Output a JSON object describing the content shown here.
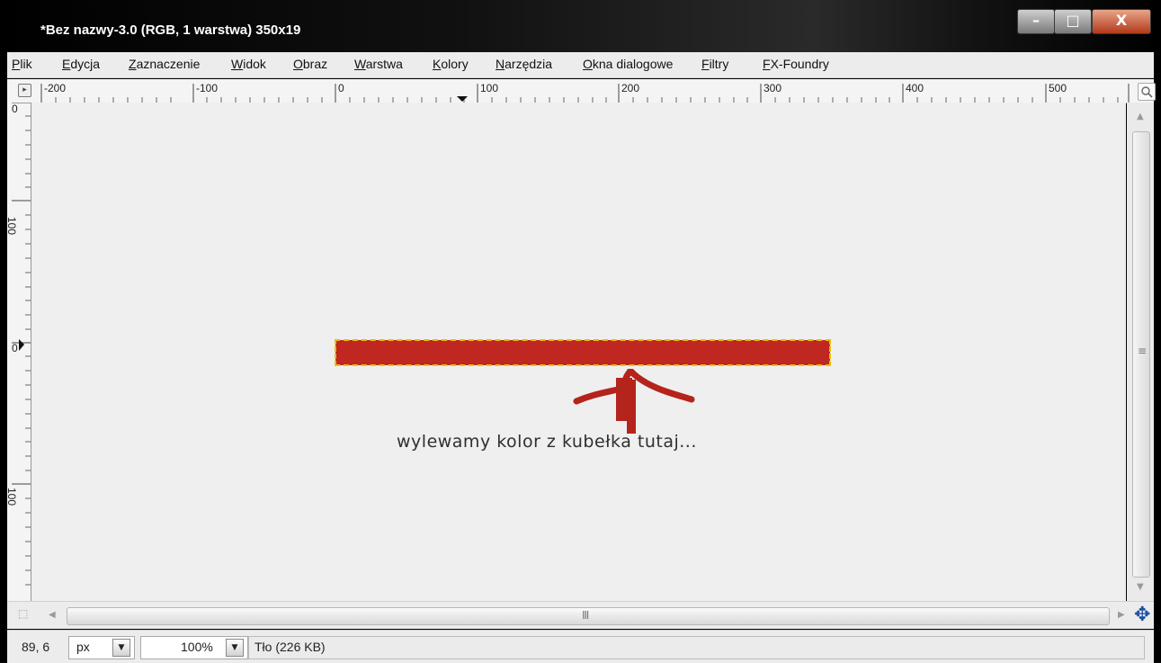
{
  "window": {
    "title": "*Bez nazwy-3.0 (RGB, 1 warstwa) 350x19",
    "controls": {
      "minimize": "–",
      "maximize": "□",
      "close": "X"
    }
  },
  "menubar": {
    "items": [
      "Plik",
      "Edycja",
      "Zaznaczenie",
      "Widok",
      "Obraz",
      "Warstwa",
      "Kolory",
      "Narzędzia",
      "Okna dialogowe",
      "Filtry",
      "FX-Foundry"
    ]
  },
  "ruler_top": {
    "labels": [
      "-200",
      "-100",
      "0",
      "100",
      "200",
      "300",
      "400",
      "500"
    ]
  },
  "ruler_left": {
    "labels": [
      "0",
      "100",
      "0",
      "100"
    ]
  },
  "canvas": {
    "bar_color": "#bf2720",
    "selection_color": "#e8c000",
    "annotation": "wylewamy kolor z kubełka tutaj..."
  },
  "statusbar": {
    "coordinates": "89, 6",
    "unit": "px",
    "zoom": "100%",
    "layer_info": "Tło (226 KB)"
  },
  "icons": [
    "navigate-icon",
    "zoom-fit-icon",
    "quick-mask-icon",
    "move-crosshair-icon",
    "dropdown-arrow-icon",
    "scroll-grip-icon"
  ]
}
